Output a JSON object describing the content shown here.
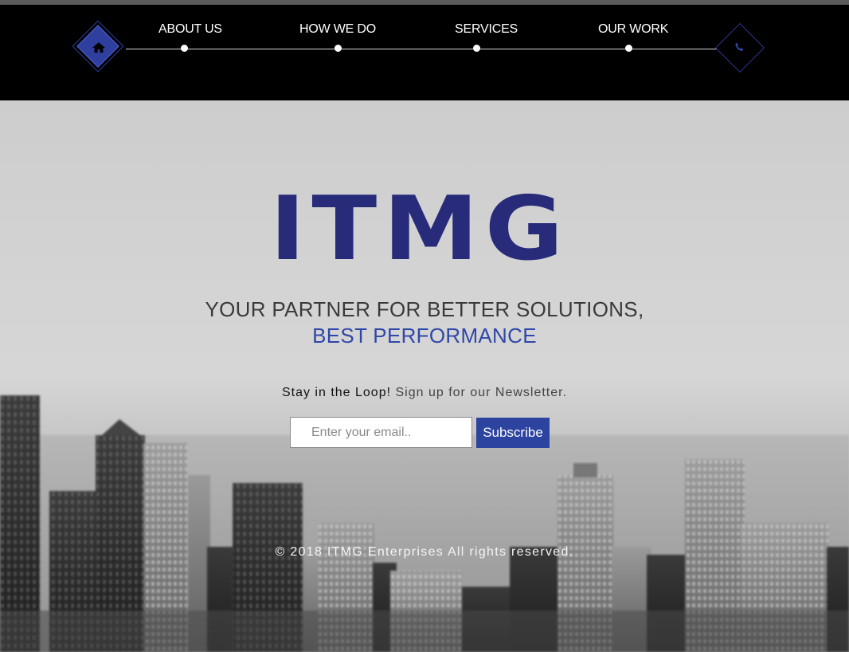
{
  "nav": {
    "items": [
      {
        "label": "ABOUT US"
      },
      {
        "label": "HOW WE DO"
      },
      {
        "label": "SERVICES"
      },
      {
        "label": "OUR WORK"
      }
    ],
    "home_icon": "home-icon",
    "phone_icon": "phone-icon"
  },
  "hero": {
    "logo_text": "ITMG",
    "tagline_line1": "YOUR PARTNER FOR BETTER SOLUTIONS,",
    "tagline_line2": "BEST PERFORMANCE",
    "newsletter_lead": "Stay in the Loop!",
    "newsletter_rest": "Sign up for our Newsletter.",
    "email_placeholder": "Enter your email..",
    "subscribe_label": "Subscribe",
    "footer": "© 2018 ITMG Enterprises All rights reserved."
  },
  "colors": {
    "brand": "#272b7a",
    "accent": "#2d43a0",
    "nav_bg": "#000000"
  }
}
